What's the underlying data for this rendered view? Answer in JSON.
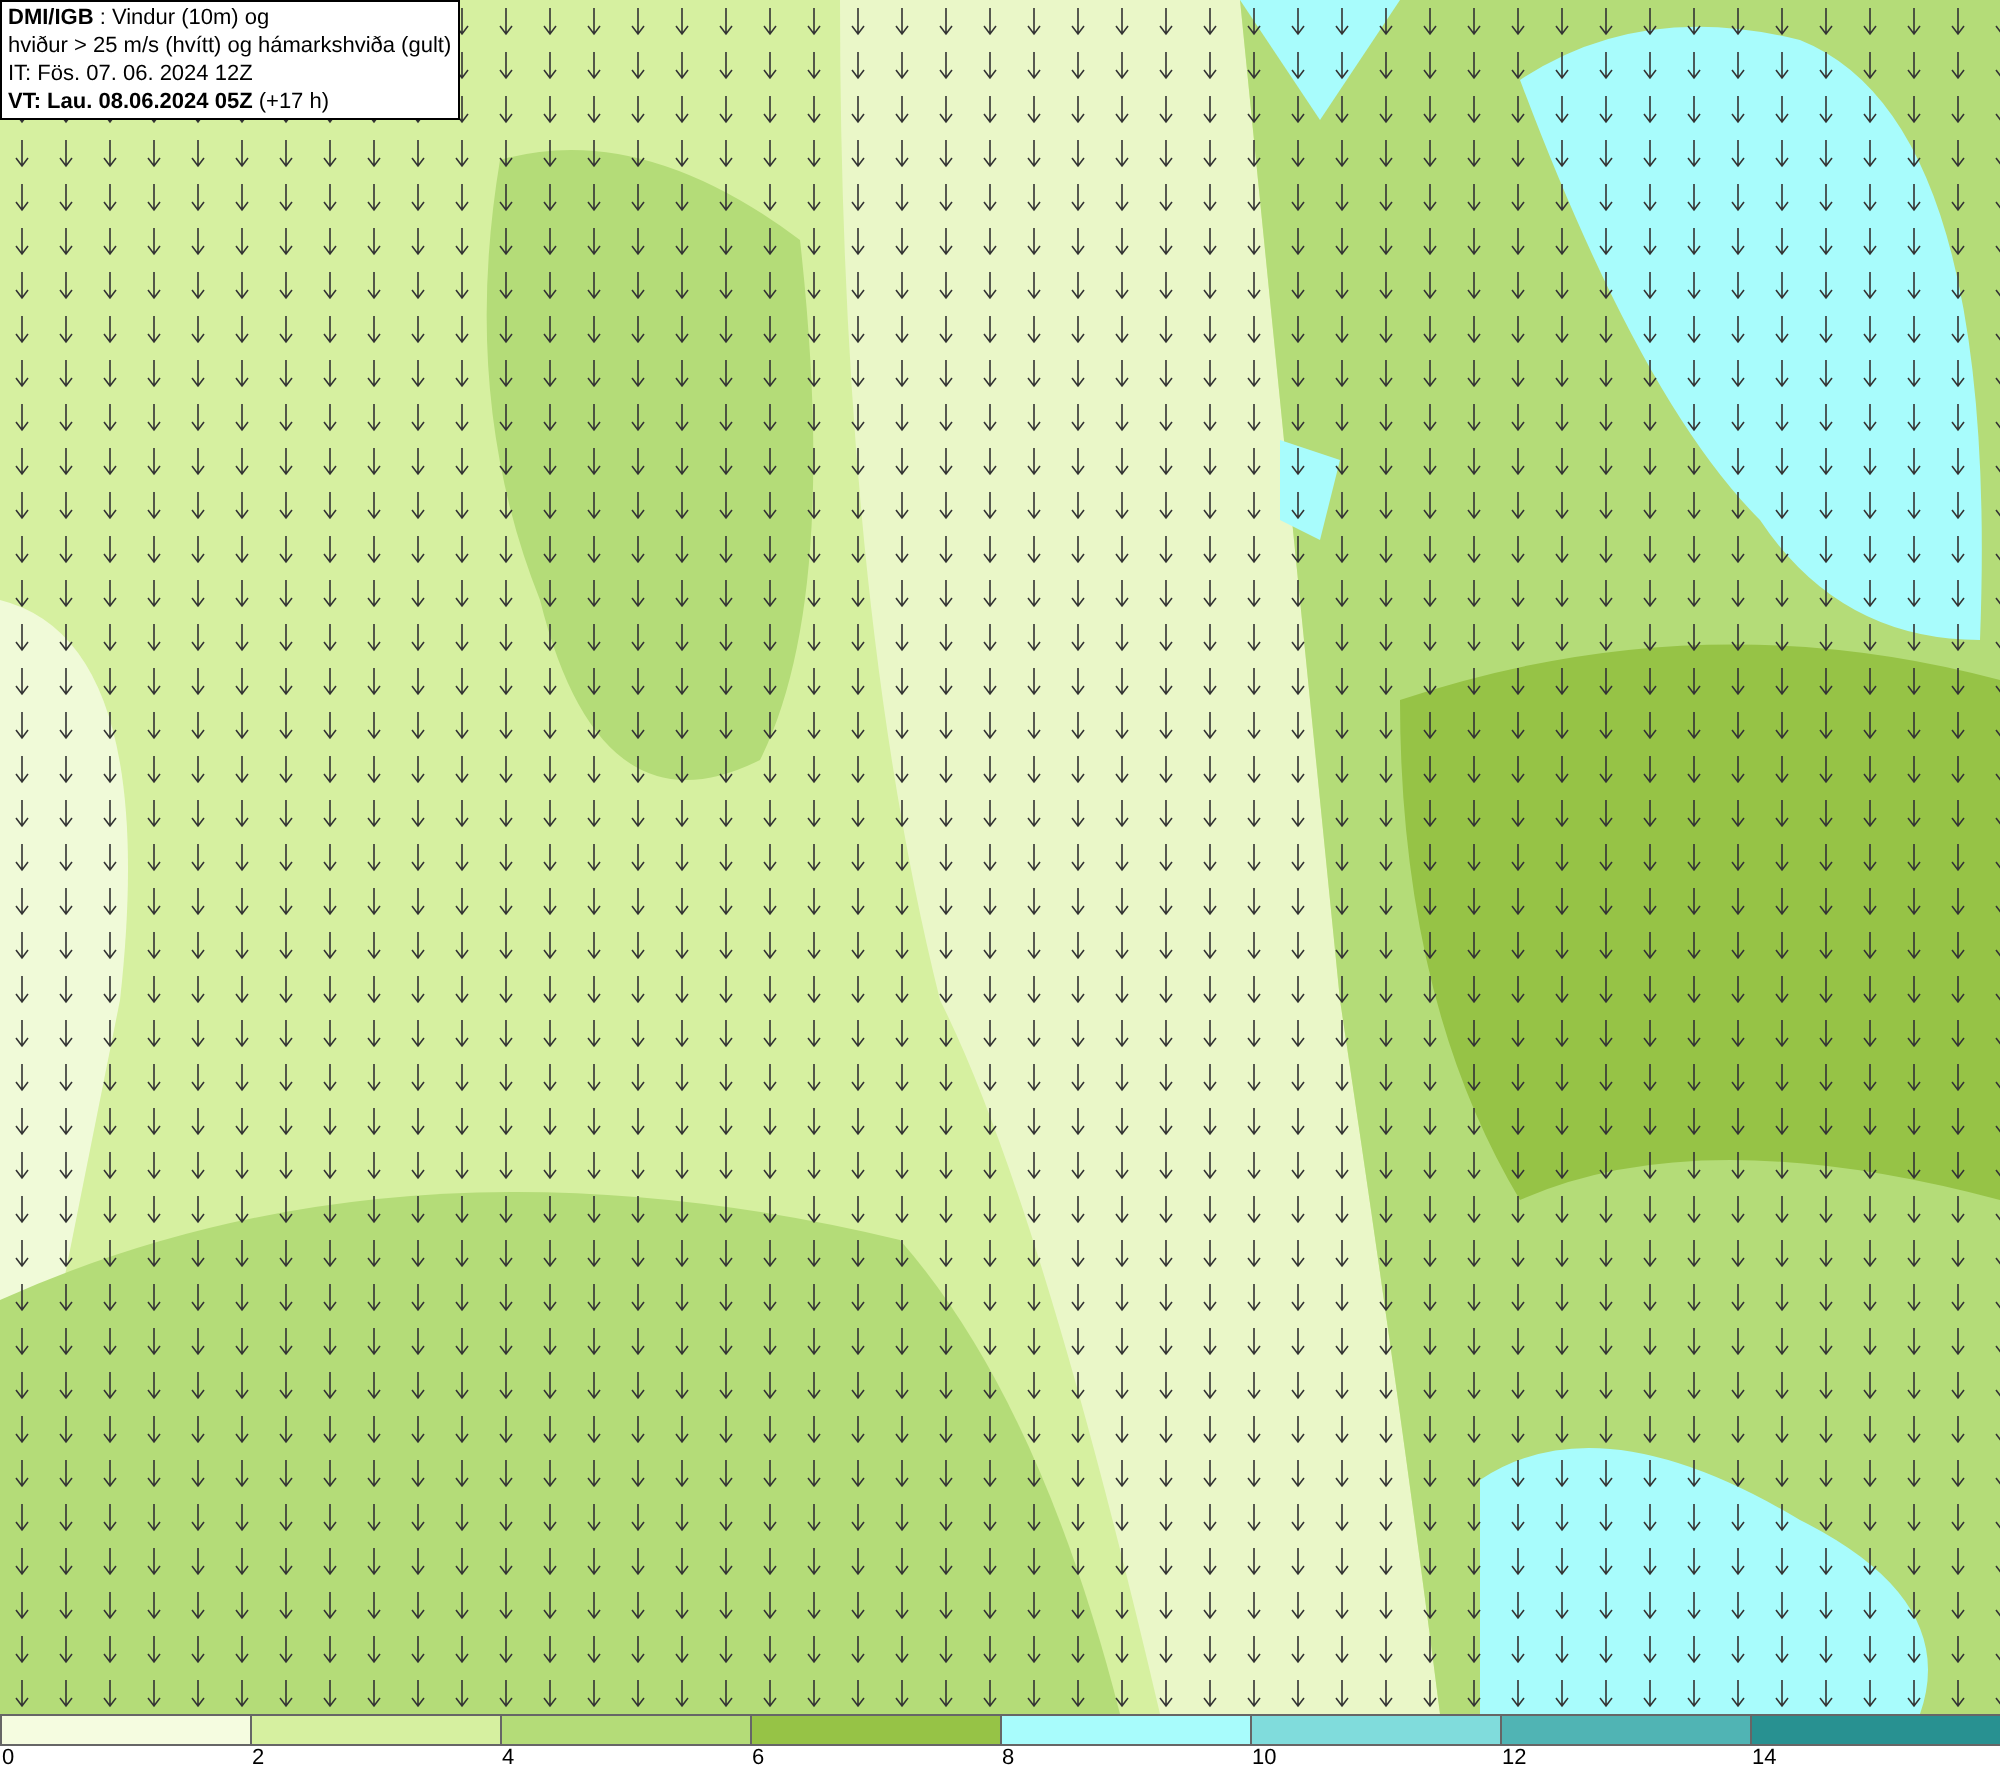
{
  "title_box": {
    "lines": [
      "**DMI/IGB** : Vindur (10m) og",
      "hviður > 25 m/s (hvítt) og hámarkshviða (gult)",
      "IT: Fös. 07. 06. 2024 12Z",
      "**VT: Lau. 08.06.2024 05Z** (+17 h)"
    ]
  },
  "legend": {
    "bins": [
      {
        "color": "#f5fce0"
      },
      {
        "color": "#d6f0a0"
      },
      {
        "color": "#b4dc78"
      },
      {
        "color": "#96c346"
      },
      {
        "color": "#a8fcfc"
      },
      {
        "color": "#80dcdc"
      },
      {
        "color": "#50b4b4"
      },
      {
        "color": "#289191"
      }
    ],
    "ticks": [
      "0",
      "2",
      "4",
      "6",
      "8",
      "10",
      "12",
      "14"
    ]
  }
}
